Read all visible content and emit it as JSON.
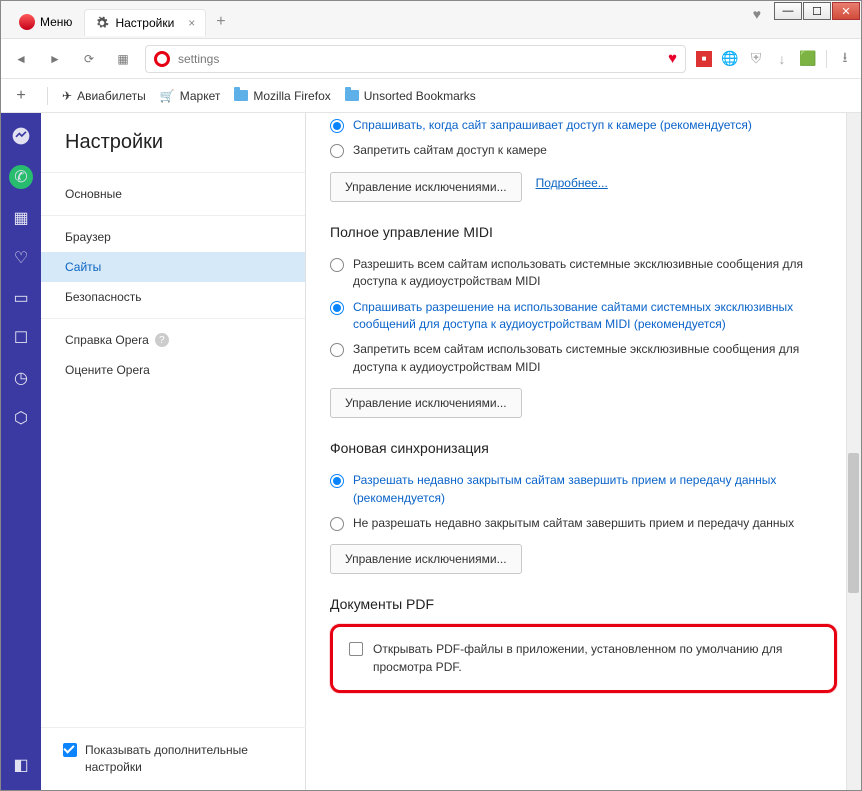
{
  "window": {
    "menu": "Меню",
    "tab": "Настройки"
  },
  "address": {
    "value": "settings"
  },
  "bookmarks": [
    "Авиабилеты",
    "Маркет",
    "Mozilla Firefox",
    "Unsorted Bookmarks"
  ],
  "nav": {
    "title": "Настройки",
    "items": [
      "Основные",
      "Браузер",
      "Сайты",
      "Безопасность"
    ],
    "help": "Справка Opera",
    "rate": "Оцените Opera",
    "show_advanced": "Показывать дополнительные настройки"
  },
  "camera": {
    "opt1": "Спрашивать, когда сайт запрашивает доступ к камере (рекомендуется)",
    "opt2": "Запретить сайтам доступ к камере",
    "btn": "Управление исключениями...",
    "link": "Подробнее..."
  },
  "midi": {
    "title": "Полное управление MIDI",
    "opt1": "Разрешить всем сайтам использовать системные эксклюзивные сообщения для доступа к аудиоустройствам MIDI",
    "opt2": "Спрашивать разрешение на использование сайтами системных эксклюзивных сообщений для доступа к аудиоустройствам MIDI (рекомендуется)",
    "opt3": "Запретить всем сайтам использовать системные эксклюзивные сообщения для доступа к аудиоустройствам MIDI",
    "btn": "Управление исключениями..."
  },
  "bg": {
    "title": "Фоновая синхронизация",
    "opt1": "Разрешать недавно закрытым сайтам завершить прием и передачу данных (рекомендуется)",
    "opt2": "Не разрешать недавно закрытым сайтам завершить прием и передачу данных",
    "btn": "Управление исключениями..."
  },
  "pdf": {
    "title": "Документы PDF",
    "label": "Открывать PDF-файлы в приложении, установленном по умолчанию для просмотра PDF."
  }
}
